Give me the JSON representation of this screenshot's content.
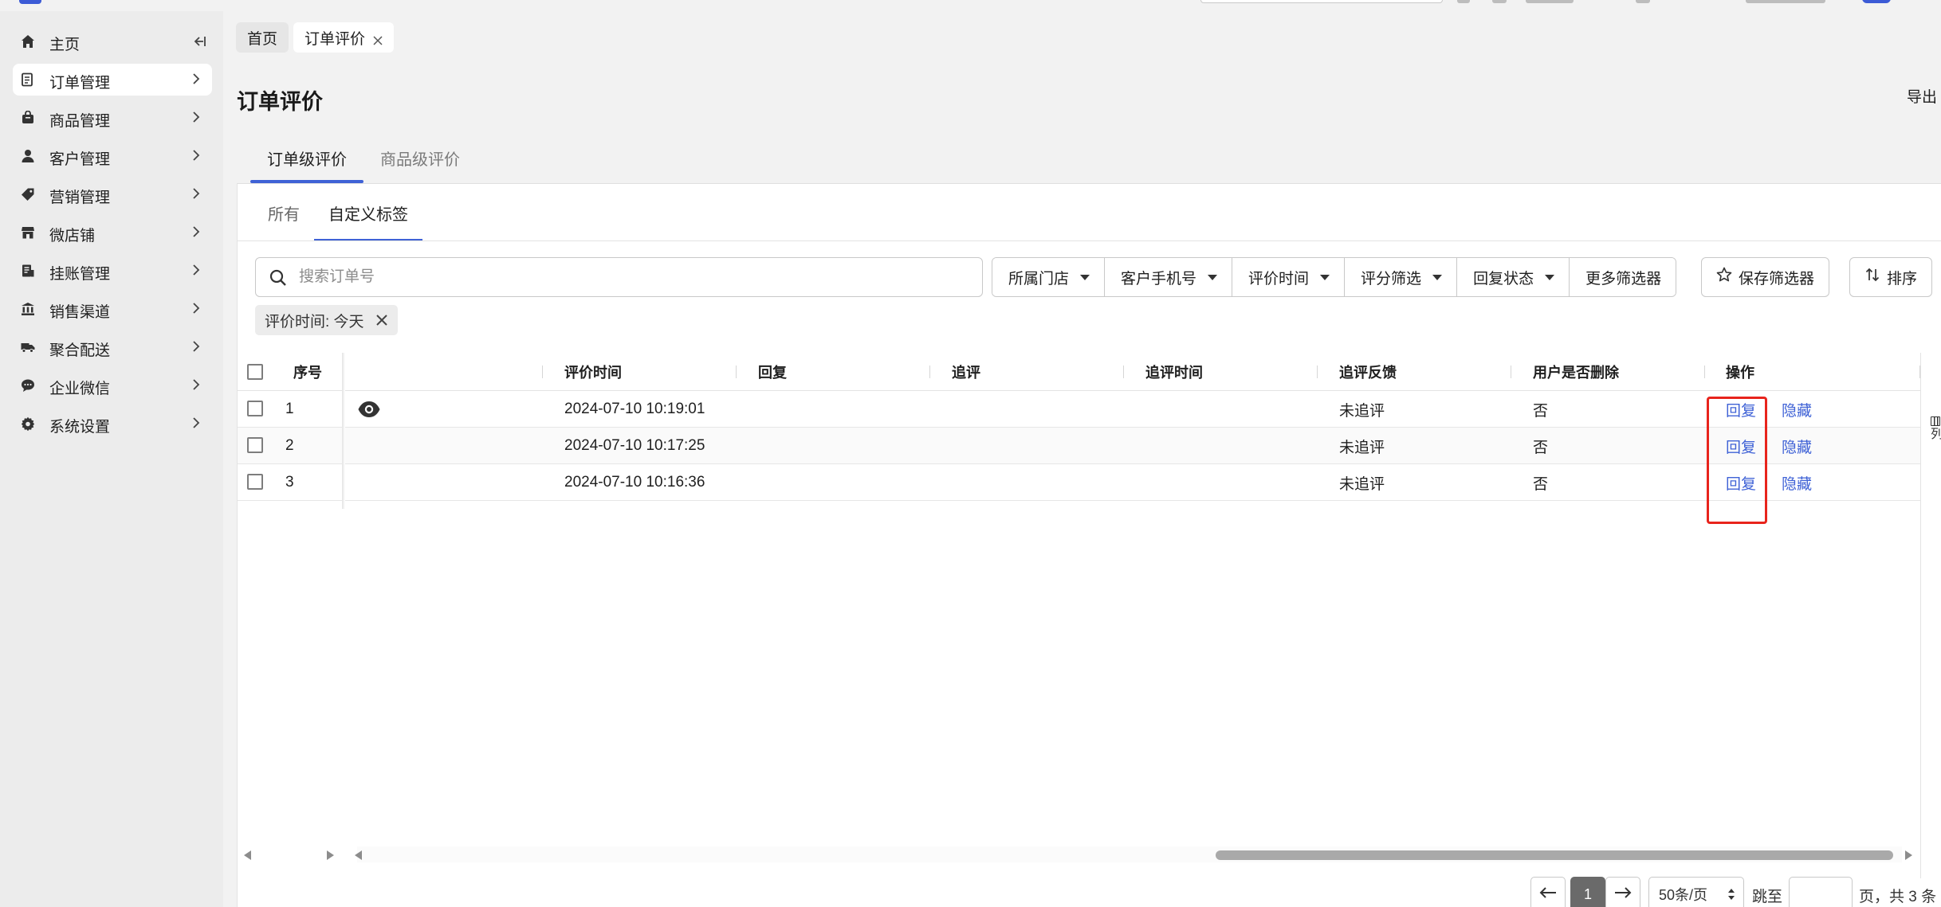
{
  "sidebar": {
    "items": [
      {
        "label": "主页",
        "icon": "home-icon"
      },
      {
        "label": "订单管理",
        "icon": "order-icon"
      },
      {
        "label": "商品管理",
        "icon": "product-icon"
      },
      {
        "label": "客户管理",
        "icon": "customer-icon"
      },
      {
        "label": "营销管理",
        "icon": "tag-icon"
      },
      {
        "label": "微店铺",
        "icon": "store-icon"
      },
      {
        "label": "挂账管理",
        "icon": "ledger-icon"
      },
      {
        "label": "销售渠道",
        "icon": "channel-icon"
      },
      {
        "label": "聚合配送",
        "icon": "delivery-icon"
      },
      {
        "label": "企业微信",
        "icon": "wechat-icon"
      },
      {
        "label": "系统设置",
        "icon": "gear-icon"
      }
    ]
  },
  "page_tabs": {
    "home": "首页",
    "current": "订单评价"
  },
  "header": {
    "title": "订单评价",
    "export": "导出"
  },
  "level_tabs": [
    "订单级评价",
    "商品级评价"
  ],
  "sub_tabs": [
    "所有",
    "自定义标签"
  ],
  "search": {
    "placeholder": "搜索订单号"
  },
  "filters": [
    "所属门店",
    "客户手机号",
    "评价时间",
    "评分筛选",
    "回复状态",
    "更多筛选器"
  ],
  "buttons": {
    "save_filter": "保存筛选器",
    "sort": "排序"
  },
  "active_filter": "评价时间: 今天",
  "table": {
    "headers": {
      "index": "序号",
      "review_time": "评价时间",
      "reply": "回复",
      "follow_up": "追评",
      "follow_up_time": "追评时间",
      "follow_up_feedback": "追评反馈",
      "user_deleted": "用户是否删除",
      "actions": "操作"
    },
    "rows": [
      {
        "index": "1",
        "review_time": "2024-07-10 10:19:01",
        "reply": "",
        "follow_up": "",
        "follow_up_time": "",
        "follow_up_feedback": "未追评",
        "user_deleted": "否",
        "action_reply": "回复",
        "action_hide": "隐藏"
      },
      {
        "index": "2",
        "review_time": "2024-07-10 10:17:25",
        "reply": "",
        "follow_up": "",
        "follow_up_time": "",
        "follow_up_feedback": "未追评",
        "user_deleted": "否",
        "action_reply": "回复",
        "action_hide": "隐藏"
      },
      {
        "index": "3",
        "review_time": "2024-07-10 10:16:36",
        "reply": "",
        "follow_up": "",
        "follow_up_time": "",
        "follow_up_feedback": "未追评",
        "user_deleted": "否",
        "action_reply": "回复",
        "action_hide": "隐藏"
      }
    ],
    "column_setting": "列"
  },
  "pagination": {
    "current_page": "1",
    "page_size": "50条/页",
    "jump_label": "跳至",
    "summary": "页，共 3 条"
  },
  "colors": {
    "accent": "#3f62d6",
    "highlight": "#e8241c"
  }
}
